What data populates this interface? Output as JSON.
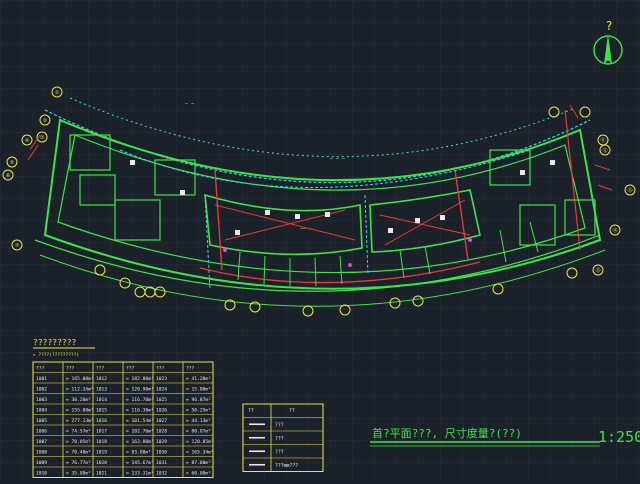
{
  "north_arrow": {
    "label": "?"
  },
  "axis_bubbles_top": [
    "①",
    "②",
    "③",
    "④",
    "⑤",
    "⑥",
    "⑦"
  ],
  "axis_bubbles_right": [
    "⑪",
    "⑫",
    "⑬",
    "⑭",
    "⑮"
  ],
  "area_table": {
    "title": "?????????",
    "subtitle": "▸ ????(?????????)",
    "headers": [
      "???",
      "???",
      "???",
      "???",
      "???",
      "???"
    ],
    "rows": [
      [
        "1001",
        "≈ 165.00m²",
        "1012",
        "≈ 182.00m²",
        "1023",
        "≈ 41.20m²"
      ],
      [
        "1002",
        "≈ 112.34m²",
        "1013",
        "≈ 120.90m²",
        "1024",
        "≈ 15.00m²"
      ],
      [
        "1003",
        "≈ 30.20m²",
        "1014",
        "≈ 116.70m²",
        "1025",
        "≈ 96.87m²"
      ],
      [
        "1004",
        "≈ 155.00m²",
        "1015",
        "≈ 116.30m²",
        "1026",
        "≈ 50.25m²"
      ],
      [
        "1005",
        "≈ 277.13m²",
        "1016",
        "≈ 101.54m²",
        "1027",
        "≈ 44.13m²"
      ],
      [
        "1006",
        "≈ 74.57m²",
        "1017",
        "≈ 182.70m²",
        "1028",
        "≈ 80.87m²"
      ],
      [
        "1007",
        "≈ 70.05m²",
        "1018",
        "≈ 163.00m²",
        "1029",
        "≈ 120.85m²"
      ],
      [
        "1008",
        "≈ 70.40m²",
        "1019",
        "≈ 83.80m²",
        "1030",
        "≈ 165.34m²"
      ],
      [
        "1009",
        "≈ 76.77m²",
        "1020",
        "≈ 145.67m²",
        "1031",
        "≈ 87.00m²"
      ],
      [
        "1010",
        "≈ 35.80m²",
        "1021",
        "≈ 133.31m²",
        "1032",
        "≈ 60.00m²"
      ]
    ]
  },
  "legend_table": {
    "headers": [
      "??",
      "??"
    ],
    "rows": [
      {
        "label": "???"
      },
      {
        "label": "???"
      },
      {
        "label": "???"
      },
      {
        "label": "???mm???"
      }
    ]
  },
  "title_block": {
    "title": "首?平面???, 尺寸度量?(??)",
    "scale": "1:250"
  },
  "colors": {
    "background": "#1b2129",
    "walls": "#3ee34a",
    "cyan": "#37d6e0",
    "red": "#e53a35",
    "yellow": "#e8e84a",
    "white": "#e8e8e8",
    "magenta": "#d34bd3"
  }
}
